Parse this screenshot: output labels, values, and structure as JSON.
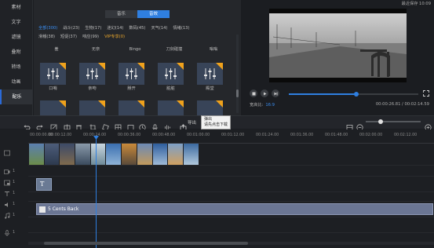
{
  "sidebar": {
    "items": [
      {
        "label": "素材",
        "active": false
      },
      {
        "label": "文字",
        "active": false
      },
      {
        "label": "滤镜",
        "active": false
      },
      {
        "label": "叠附",
        "active": false
      },
      {
        "label": "转场",
        "active": false
      },
      {
        "label": "动画",
        "active": false
      },
      {
        "label": "配乐",
        "active": true
      }
    ]
  },
  "library": {
    "tabs": [
      {
        "label": "音乐",
        "active": false
      },
      {
        "label": "音效",
        "active": true
      }
    ],
    "categories": [
      {
        "label": "全部(300)",
        "state": "active"
      },
      {
        "label": "战斗(23)",
        "state": ""
      },
      {
        "label": "生物(17)",
        "state": ""
      },
      {
        "label": "迷幻(14)",
        "state": ""
      },
      {
        "label": "数码(45)",
        "state": ""
      },
      {
        "label": "天气(14)",
        "state": ""
      },
      {
        "label": "情绪(13)",
        "state": ""
      },
      {
        "label": "滑稽(38)",
        "state": ""
      },
      {
        "label": "短促(37)",
        "state": ""
      },
      {
        "label": "响应(99)",
        "state": ""
      },
      {
        "label": "VIP专享(0)",
        "state": "vip"
      }
    ],
    "row1_labels": [
      "羞",
      "无奈",
      "Bingo",
      "刀剑碰撞",
      "嗡嗡"
    ],
    "tile_labels": [
      "口哨",
      "亲吻",
      "掰开",
      "脏脏",
      "殿堂"
    ]
  },
  "preview": {
    "autosave": "最近保存 10:09",
    "aspect_label": "宽高比:",
    "aspect_value": "16:9",
    "current_time": "00:00:26.81",
    "total_time": "00:02:14.59",
    "time_separator": " / ",
    "progress": 0.52
  },
  "toolbar": {
    "export_label": "导出",
    "tooltip_line1": "弹出",
    "tooltip_line2": "请先点击下载",
    "zoom_level": 0.25
  },
  "timeline": {
    "ruler_ticks": [
      "00:00:00.00",
      "00:00:12.00",
      "00:00:24.00",
      "00:00:36.00",
      "00:00:48.00",
      "00:01:00.00",
      "00:01:12.00",
      "00:01:24.00",
      "00:01:36.00",
      "00:01:48.00",
      "00:02:00.00",
      "00:02:12.00"
    ],
    "tracks": [
      {
        "icon": "image-icon",
        "num": ""
      },
      {
        "icon": "video-icon",
        "num": "1"
      },
      {
        "icon": "pip-icon",
        "num": "1"
      },
      {
        "icon": "text-icon",
        "num": "1"
      },
      {
        "icon": "audio-icon",
        "num": "1"
      },
      {
        "icon": "music-icon",
        "num": "1"
      },
      {
        "icon": "mic-icon",
        "num": "1"
      }
    ],
    "text_clip_label": "T",
    "music_clip_name": "5 Cents Back"
  }
}
